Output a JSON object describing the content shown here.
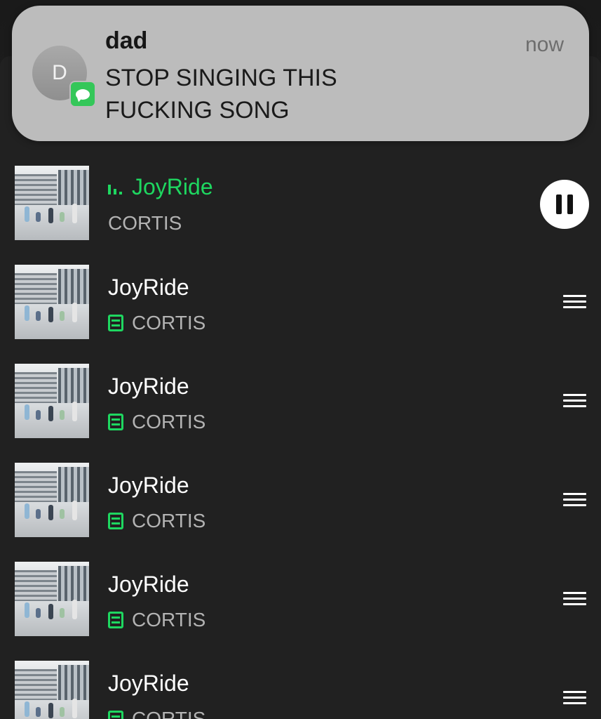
{
  "notification": {
    "avatar_initial": "D",
    "sender": "dad",
    "time": "now",
    "message": "STOP SINGING THIS\nFUCKING SONG",
    "app_icon": "messages-icon",
    "accent_color": "#34c759"
  },
  "queue": {
    "accent_color": "#1ed760",
    "now_playing": {
      "title": "JoyRide",
      "artist": "CORTIS",
      "indicator_icon": "equalizer-icon",
      "control_icon": "pause-icon"
    },
    "items": [
      {
        "title": "JoyRide",
        "artist": "CORTIS",
        "badge_icon": "lyrics-icon",
        "handle_icon": "drag-handle-icon"
      },
      {
        "title": "JoyRide",
        "artist": "CORTIS",
        "badge_icon": "lyrics-icon",
        "handle_icon": "drag-handle-icon"
      },
      {
        "title": "JoyRide",
        "artist": "CORTIS",
        "badge_icon": "lyrics-icon",
        "handle_icon": "drag-handle-icon"
      },
      {
        "title": "JoyRide",
        "artist": "CORTIS",
        "badge_icon": "lyrics-icon",
        "handle_icon": "drag-handle-icon"
      },
      {
        "title": "JoyRide",
        "artist": "CORTIS",
        "badge_icon": "lyrics-icon",
        "handle_icon": "drag-handle-icon"
      }
    ]
  }
}
